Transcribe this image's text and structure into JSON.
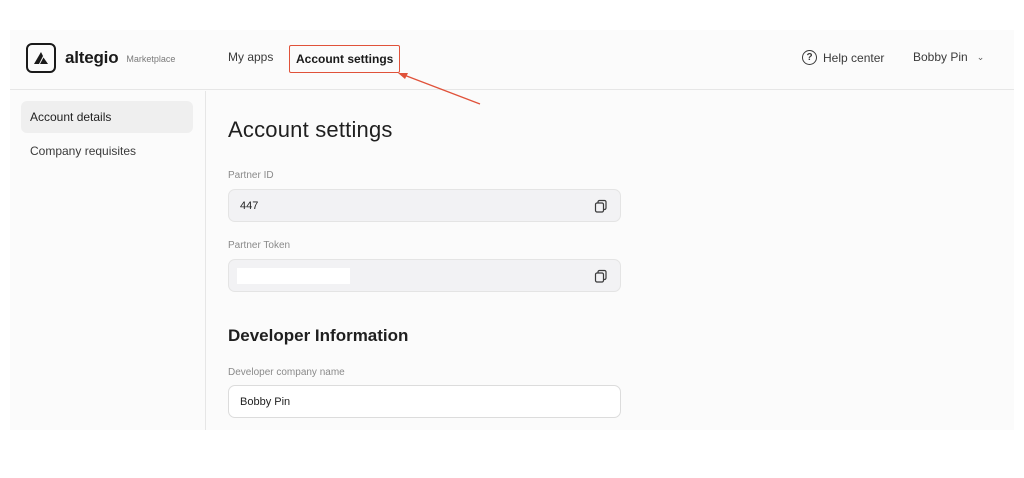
{
  "brand": {
    "name": "altegio",
    "sub": "Marketplace",
    "logo_icon": "altegio-logo-icon"
  },
  "header": {
    "nav": [
      {
        "label": "My apps"
      },
      {
        "label": "Account settings",
        "highlighted": true
      }
    ],
    "help_label": "Help center",
    "help_icon": "question-circle-icon",
    "user_name": "Bobby Pin",
    "user_chevron": "chevron-down-icon"
  },
  "sidebar": {
    "items": [
      {
        "label": "Account details",
        "active": true
      },
      {
        "label": "Company requisites",
        "active": false
      }
    ]
  },
  "main": {
    "title": "Account settings",
    "fields": [
      {
        "label": "Partner ID",
        "value": "447",
        "icon": "copy-icon"
      },
      {
        "label": "Partner Token",
        "value": "",
        "icon": "copy-icon",
        "masked": true
      }
    ],
    "developer_section_title": "Developer Information",
    "developer_fields": [
      {
        "label": "Developer company name",
        "value": "Bobby Pin"
      }
    ]
  },
  "colors": {
    "highlight": "#e0523a",
    "background": "#fbfbfb",
    "field_bg": "#f2f2f4"
  }
}
